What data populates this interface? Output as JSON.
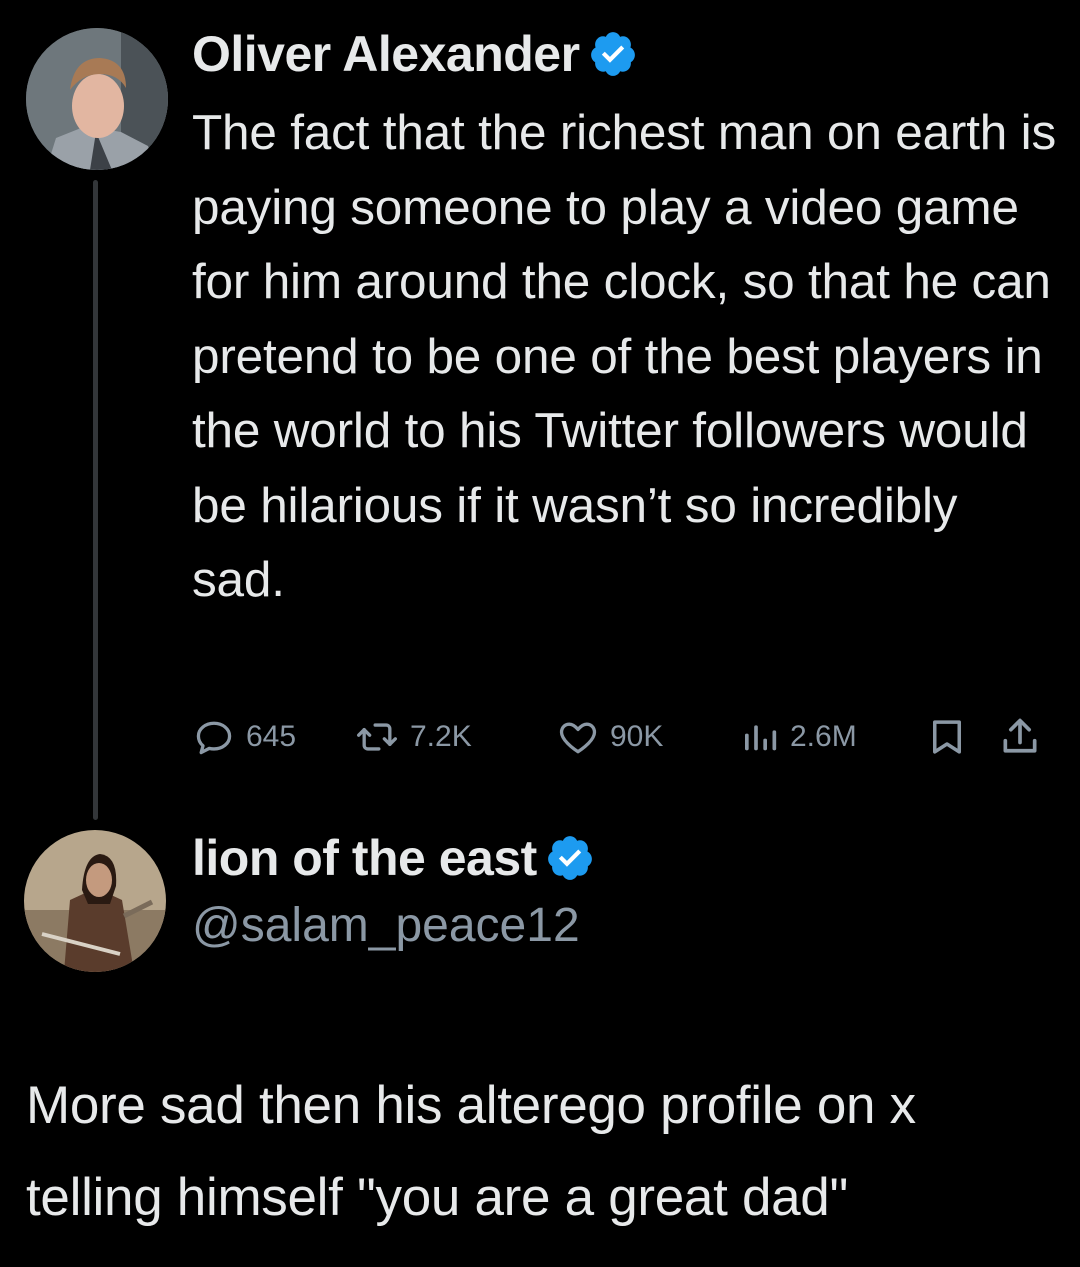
{
  "original_tweet": {
    "author_name": "Oliver Alexander",
    "verified": true,
    "text": "The fact that the richest man on earth is paying someone to play a video game for him around the clock, so that he can pretend to be one of the best players in the world to his Twitter followers would be hilarious if it wasn’t so incredibly sad.",
    "actions": {
      "reply_icon": "reply-icon",
      "reply_count": "645",
      "retweet_icon": "retweet-icon",
      "retweet_count": "7.2K",
      "like_icon": "heart-icon",
      "like_count": "90K",
      "views_icon": "views-icon",
      "views_count": "2.6M",
      "bookmark_icon": "bookmark-icon",
      "share_icon": "share-icon"
    }
  },
  "reply_tweet": {
    "author_name": "lion of the east",
    "verified": true,
    "handle": "@salam_peace12",
    "text": "More sad then his alterego profile on x telling himself \"you are a great dad\""
  },
  "colors": {
    "background": "#000000",
    "primary_text": "#e7e9ea",
    "secondary_text": "#8b98a5",
    "verified_blue": "#1d9bf0",
    "thread_line": "#333639"
  }
}
